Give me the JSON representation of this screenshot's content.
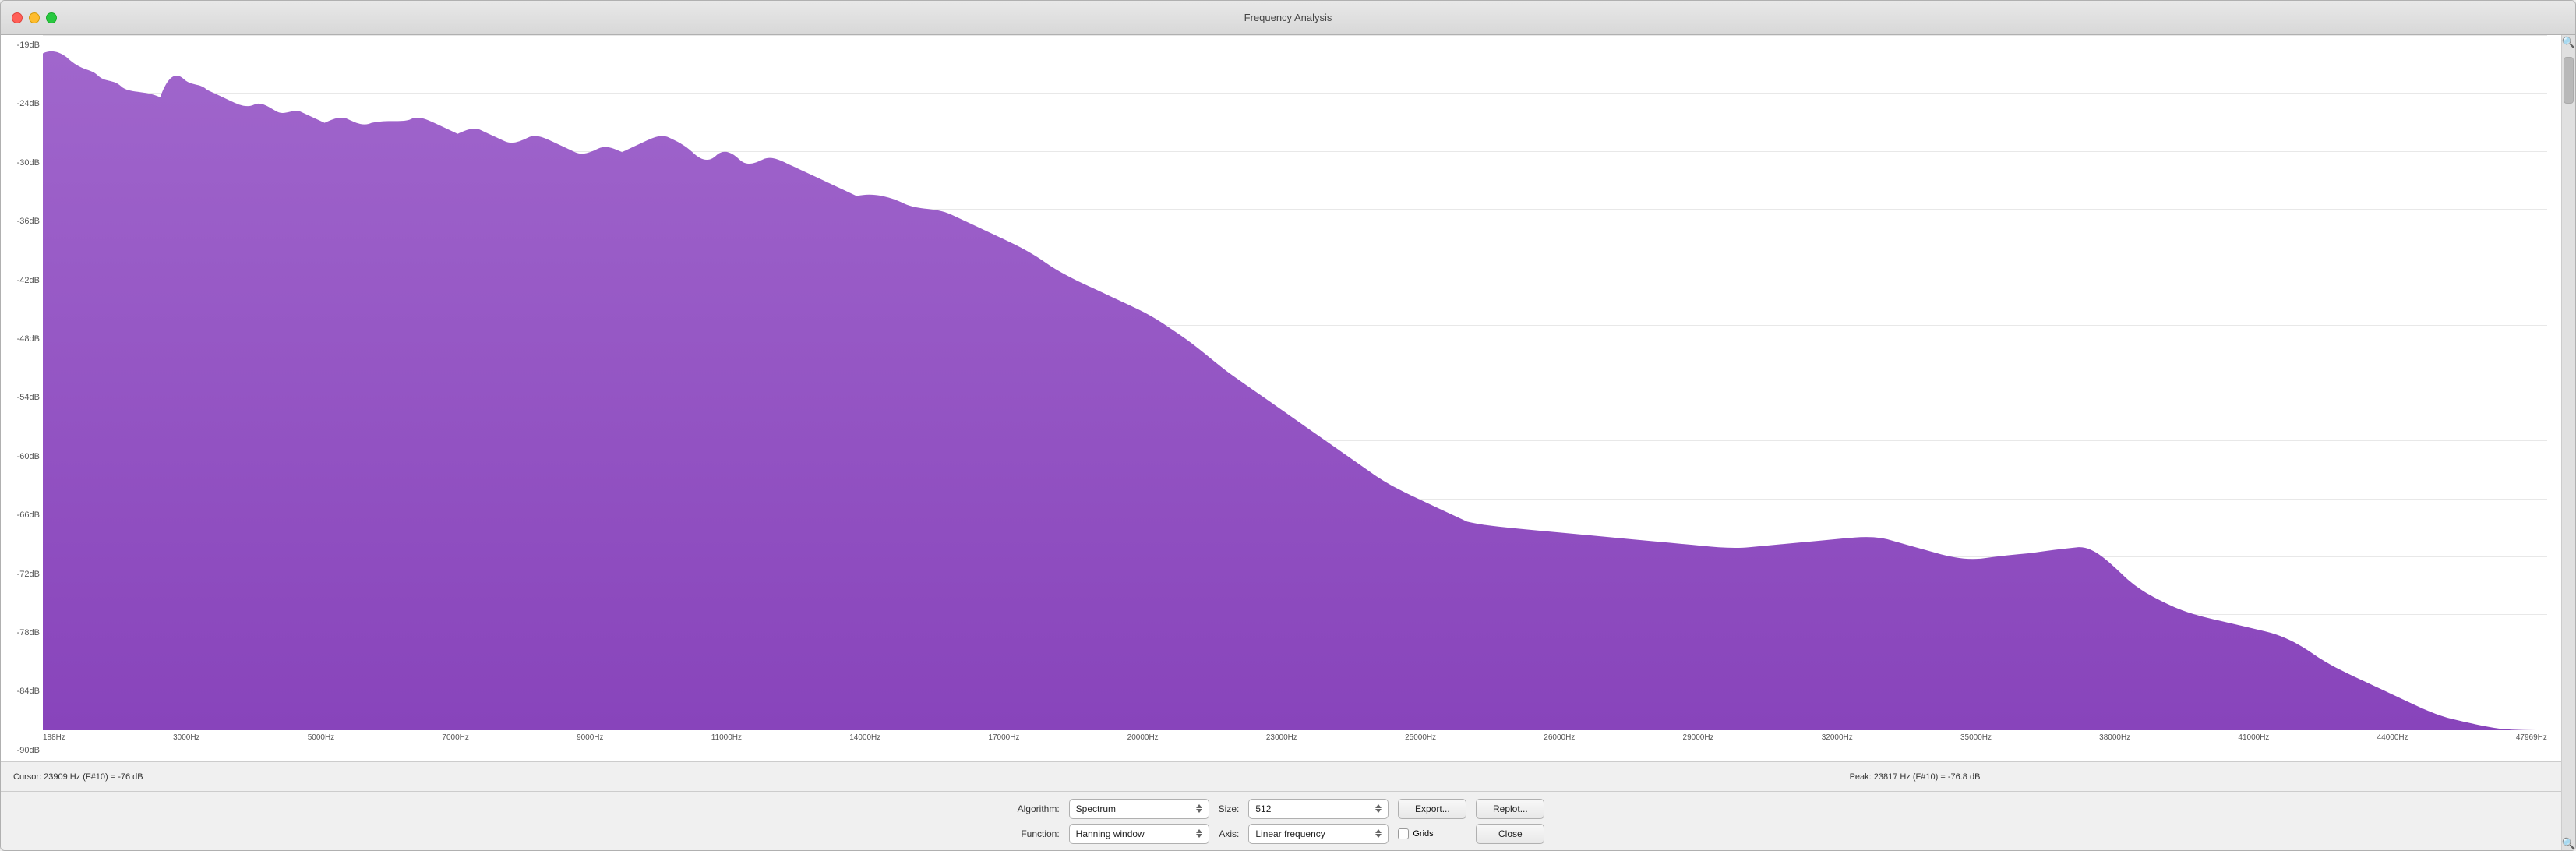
{
  "window": {
    "title": "Frequency Analysis"
  },
  "titlebar": {
    "close_label": "",
    "min_label": "",
    "max_label": ""
  },
  "yAxis": {
    "labels": [
      "-19dB",
      "-24dB",
      "-30dB",
      "-36dB",
      "-42dB",
      "-48dB",
      "-54dB",
      "-60dB",
      "-66dB",
      "-72dB",
      "-78dB",
      "-84dB",
      "-90dB"
    ]
  },
  "xAxis": {
    "labels": [
      "188Hz",
      "3000Hz",
      "5000Hz",
      "7000Hz",
      "9000Hz",
      "11000Hz",
      "14000Hz",
      "17000Hz",
      "20000Hz",
      "23000Hz",
      "25000Hz",
      "26000Hz",
      "29000Hz",
      "32000Hz",
      "35000Hz",
      "38000Hz",
      "41000Hz",
      "44000Hz",
      "47969Hz"
    ]
  },
  "statusBar": {
    "cursor_text": "Cursor:  23909 Hz (F#10) = -76 dB",
    "peak_text": "Peak:  23817 Hz (F#10) = -76.8 dB"
  },
  "controls": {
    "algorithm_label": "Algorithm:",
    "algorithm_value": "Spectrum",
    "size_label": "Size:",
    "size_value": "512",
    "export_label": "Export...",
    "replot_label": "Replot...",
    "function_label": "Function:",
    "function_value": "Hanning window",
    "axis_label": "Axis:",
    "axis_value": "Linear frequency",
    "grids_label": "Grids",
    "close_label": "Close"
  },
  "chart": {
    "cursor_x_percent": 47.5,
    "spectrum_color": "#a066cc",
    "background_color": "#ffffff"
  }
}
